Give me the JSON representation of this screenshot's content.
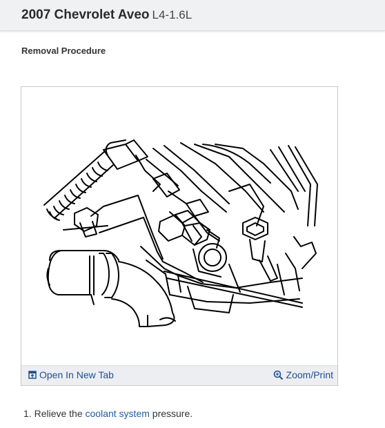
{
  "header": {
    "model": "2007 Chevrolet Aveo",
    "engine": "L4-1.6L"
  },
  "section": {
    "title": "Removal Procedure"
  },
  "figure": {
    "open_new_tab_label": "Open In New Tab",
    "zoom_print_label": "Zoom/Print",
    "open_icon": "open-in-new-tab-icon",
    "zoom_icon": "zoom-in-icon"
  },
  "steps": [
    {
      "number": "1.",
      "prefix": "Relieve the",
      "link": "coolant system",
      "suffix": "pressure."
    }
  ],
  "colors": {
    "link": "#1f5a9e",
    "header_bg": "#f0f1f2",
    "figure_footer_bg": "#eceef2"
  }
}
